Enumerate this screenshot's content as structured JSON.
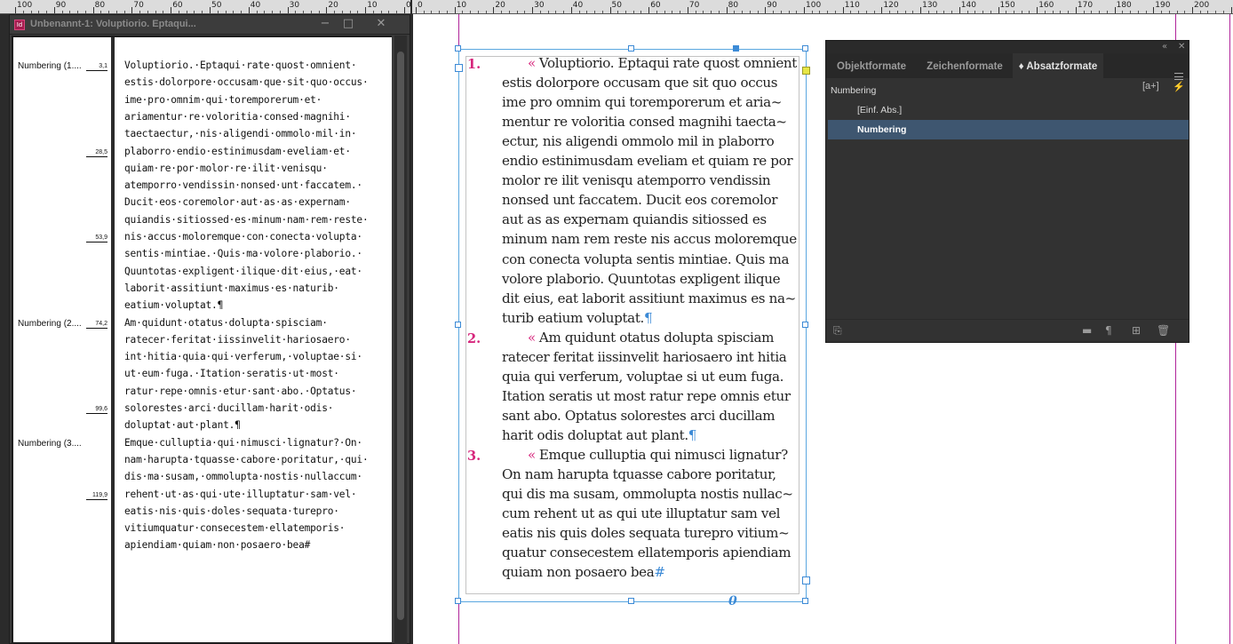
{
  "rulers": {
    "left_labels": [
      "100",
      "90",
      "80",
      "70",
      "60",
      "50",
      "40",
      "30",
      "20",
      "10",
      "0",
      "10",
      "20"
    ],
    "right_labels": [
      "0",
      "10",
      "20",
      "30",
      "40",
      "50",
      "60",
      "70",
      "80",
      "90",
      "100",
      "110",
      "120",
      "130",
      "140",
      "150",
      "160",
      "170",
      "180",
      "190",
      "200",
      "21"
    ]
  },
  "story_editor": {
    "window_title": "Unbenannt-1: Voluptiorio. Eptaqui...",
    "app_badge": "Id",
    "controls": {
      "minimize": "−",
      "maximize": "□",
      "close": "✕"
    },
    "paragraph_labels": [
      "Numbering (1....",
      "Numbering (2....",
      "Numbering (3...."
    ],
    "depths": [
      "3,1",
      "28,5",
      "53,9",
      "74,2",
      "99,6",
      "119,9"
    ],
    "lines": [
      "Voluptiorio.·Eptaqui·rate·quost·omnient·",
      "estis·dolorpore·occusam·que·sit·quo·occus·",
      "ime·pro·omnim·qui·toremporerum·et·",
      "ariamentur·re·voloritia·consed·magnihi·",
      "taectaectur,·nis·aligendi·ommolo·mil·in·",
      "plaborro·endio·estinimusdam·eveliam·et·",
      "quiam·re·por·molor·re·ilit·venisqu·",
      "atemporro·vendissin·nonsed·unt·faccatem.·",
      "Ducit·eos·coremolor·aut·as·as·expernam·",
      "quiandis·sitiossed·es·minum·nam·rem·reste·",
      "nis·accus·moloremque·con·conecta·volupta·",
      "sentis·mintiae.·Quis·ma·volore·plaborio.·",
      "Quuntotas·expligent·ilique·dit·eius,·eat·",
      "laborit·assitiunt·maximus·es·naturib·",
      "eatium·voluptat.¶",
      "Am·quidunt·otatus·dolupta·spisciam·",
      "ratecer·feritat·iissinvelit·hariosaero·",
      "int·hitia·quia·qui·verferum,·voluptae·si·",
      "ut·eum·fuga.·Itation·seratis·ut·most·",
      "ratur·repe·omnis·etur·sant·abo.·Optatus·",
      "solorestes·arci·ducillam·harit·odis·",
      "doluptat·aut·plant.¶",
      "Emque·culluptia·qui·nimusci·lignatur?·On·",
      "nam·harupta·tquasse·cabore·poritatur,·qui·",
      "dis·ma·susam,·ommolupta·nostis·nullaccum·",
      "rehent·ut·as·qui·ute·illuptatur·sam·vel·",
      "eatis·nis·quis·doles·sequata·turepro·",
      "vitiumquatur·consecestem·ellatemporis·",
      "apiendiam·quiam·non·posaero·bea#"
    ]
  },
  "layout_text": {
    "numbers": [
      "1.",
      "2.",
      "3."
    ],
    "guillemet": "«",
    "lines": [
      "Voluptiorio. Eptaqui rate quost omnient",
      "estis dolorpore occusam que sit quo occus",
      "ime pro omnim qui toremporerum et aria~",
      "mentur re voloritia consed magnihi taecta~",
      "ectur, nis aligendi ommolo mil in plaborro",
      "endio estinimusdam eveliam et quiam re por",
      "molor re ilit venisqu atemporro vendissin",
      "nonsed unt faccatem. Ducit eos coremolor",
      "aut as as expernam quiandis sitiossed es",
      "minum nam rem reste nis accus moloremque",
      "con conecta volupta sentis mintiae. Quis ma",
      "volore plaborio. Quuntotas expligent ilique",
      "dit eius, eat laborit assitiunt maximus es na~",
      "turib eatium voluptat.",
      "Am quidunt otatus dolupta spisciam",
      "ratecer feritat iissinvelit hariosaero int hitia",
      "quia qui verferum, voluptae si ut eum fuga.",
      "Itation seratis ut most ratur repe omnis etur",
      "sant abo. Optatus solorestes arci ducillam",
      "harit odis doluptat aut plant.",
      "Emque culluptia qui nimusci lignatur?",
      "On nam harupta tquasse cabore poritatur,",
      "qui dis ma susam, ommolupta nostis nullac~",
      "cum rehent ut as qui ute illuptatur sam vel",
      "eatis nis quis doles sequata turepro vitium~",
      "quatur consecestem ellatemporis apiendiam",
      "quiam non posaero bea"
    ],
    "pilcrow": "¶",
    "story_end": "#",
    "overset_marker": "0"
  },
  "panel": {
    "collapse_icon": "«",
    "close_icon": "✕",
    "tabs": [
      {
        "label": "Objektformate"
      },
      {
        "label": "Zeichenformate"
      },
      {
        "label": "♦ Absatzformate"
      }
    ],
    "current_style": "Numbering",
    "new_style_button": "[a+]",
    "quick_apply": "⚡",
    "styles": [
      {
        "name": "[Einf. Abs.]"
      },
      {
        "name": "Numbering"
      }
    ],
    "bottom_icons": [
      "load-styles-icon",
      "folder-icon",
      "clear-overrides-icon",
      "new-style-icon",
      "trash-icon"
    ]
  },
  "colors": {
    "accent_magenta": "#d6247b",
    "frame_blue": "#3c8ad6",
    "selection": "#3e5670",
    "page_margin": "#b0249a"
  }
}
